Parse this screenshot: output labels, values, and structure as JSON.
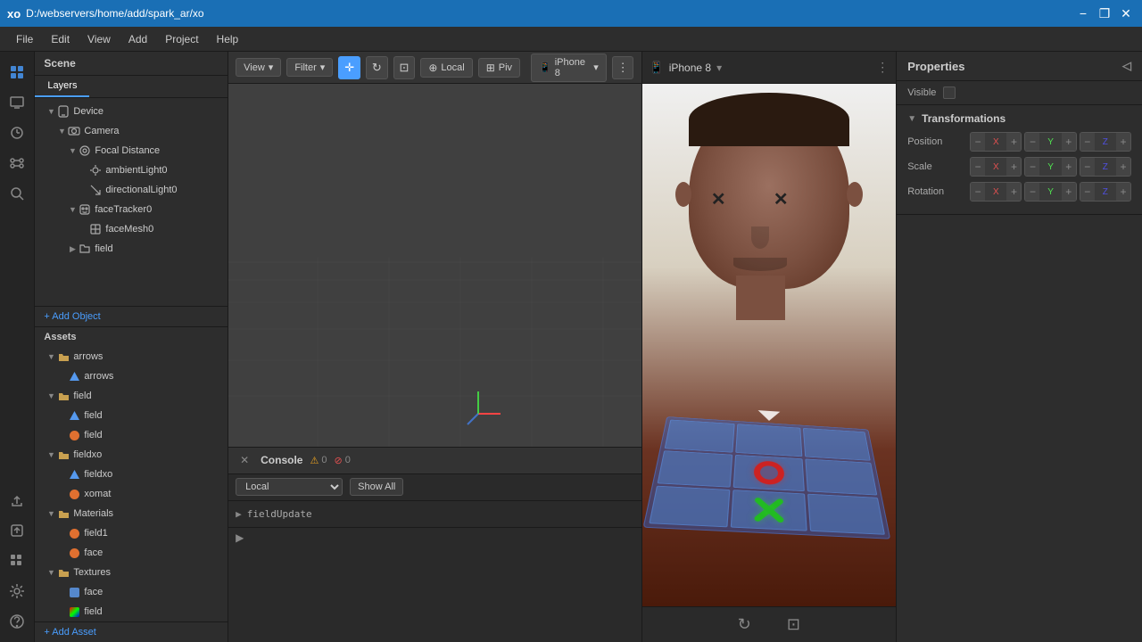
{
  "titlebar": {
    "icon": "xo",
    "path": "D:/webservers/home/add/spark_ar/xo",
    "minimize": "−",
    "restore": "❐",
    "close": "✕"
  },
  "menubar": {
    "items": [
      "File",
      "Edit",
      "View",
      "Add",
      "Project",
      "Help"
    ]
  },
  "scene": {
    "header": "Scene",
    "tabs": [
      "Layers"
    ],
    "tree": [
      {
        "label": "Device",
        "icon": "📦",
        "indent": 1,
        "arrow": "▼"
      },
      {
        "label": "Camera",
        "icon": "📷",
        "indent": 2,
        "arrow": "▼"
      },
      {
        "label": "Focal Distance",
        "icon": "🎯",
        "indent": 3,
        "arrow": "▼"
      },
      {
        "label": "ambientLight0",
        "icon": "💡",
        "indent": 4,
        "arrow": ""
      },
      {
        "label": "directionalLight0",
        "icon": "↘",
        "indent": 4,
        "arrow": ""
      },
      {
        "label": "faceTracker0",
        "icon": "📁",
        "indent": 3,
        "arrow": "▼"
      },
      {
        "label": "faceMesh0",
        "icon": "🔲",
        "indent": 4,
        "arrow": ""
      },
      {
        "label": "field",
        "icon": "📁",
        "indent": 3,
        "arrow": "▶"
      }
    ],
    "add_object": "+ Add Object"
  },
  "assets": {
    "header": "Assets",
    "items": [
      {
        "label": "arrows",
        "icon": "📁",
        "indent": 1,
        "arrow": "▼"
      },
      {
        "label": "arrows",
        "icon": "🔷",
        "indent": 2,
        "arrow": ""
      },
      {
        "label": "field",
        "icon": "📁",
        "indent": 1,
        "arrow": "▼"
      },
      {
        "label": "field",
        "icon": "🔷",
        "indent": 2,
        "arrow": ""
      },
      {
        "label": "field",
        "icon": "🟠",
        "indent": 2,
        "arrow": ""
      },
      {
        "label": "fieldxo",
        "icon": "📁",
        "indent": 1,
        "arrow": "▼"
      },
      {
        "label": "fieldxo",
        "icon": "🔷",
        "indent": 2,
        "arrow": ""
      },
      {
        "label": "xomat",
        "icon": "🟠",
        "indent": 2,
        "arrow": ""
      },
      {
        "label": "Materials",
        "icon": "📁",
        "indent": 1,
        "arrow": "▼"
      },
      {
        "label": "field1",
        "icon": "🟠",
        "indent": 2,
        "arrow": ""
      },
      {
        "label": "face",
        "icon": "🟠",
        "indent": 2,
        "arrow": ""
      },
      {
        "label": "Textures",
        "icon": "📁",
        "indent": 1,
        "arrow": "▼"
      },
      {
        "label": "face",
        "icon": "🖼",
        "indent": 2,
        "arrow": ""
      },
      {
        "label": "field",
        "icon": "🌈",
        "indent": 2,
        "arrow": ""
      }
    ],
    "add_asset": "+ Add Asset"
  },
  "viewport": {
    "view_btn": "View",
    "filter_btn": "Filter",
    "local_btn": "Local",
    "pivot_btn": "Piv",
    "device_name": "iPhone 8"
  },
  "console": {
    "title": "Console",
    "warning_count": "0",
    "error_count": "0",
    "local_option": "Local",
    "show_all_btn": "Show All",
    "log_entry": "fieldUpdate"
  },
  "properties": {
    "header": "Properties",
    "visible_label": "Visible",
    "transformations_label": "Transformations",
    "position_label": "Position",
    "scale_label": "Scale",
    "rotation_label": "Rotation",
    "minus": "−",
    "plus": "+",
    "x_label": "X",
    "y_label": "Y",
    "z_label": "Z"
  }
}
